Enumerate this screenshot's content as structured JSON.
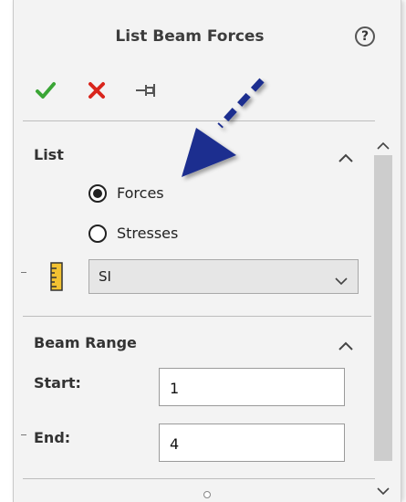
{
  "header": {
    "title": "List Beam Forces",
    "help_glyph": "?"
  },
  "toolbar": {
    "icons": [
      "ok-check-icon",
      "cancel-x-icon",
      "pushpin-icon"
    ]
  },
  "list_section": {
    "title": "List",
    "options": [
      {
        "label": "Forces",
        "selected": true
      },
      {
        "label": "Stresses",
        "selected": false
      }
    ],
    "units": {
      "icon": "ruler-icon",
      "value": "SI"
    }
  },
  "beam_range": {
    "title": "Beam Range",
    "start": {
      "label": "Start:",
      "value": "1"
    },
    "end": {
      "label": "End:",
      "value": "4"
    }
  },
  "colors": {
    "ok_green": "#3aa535",
    "cancel_red": "#d9251c",
    "annotation_arrow": "#1c2f8f",
    "panel_bg": "#f3f3f3"
  }
}
